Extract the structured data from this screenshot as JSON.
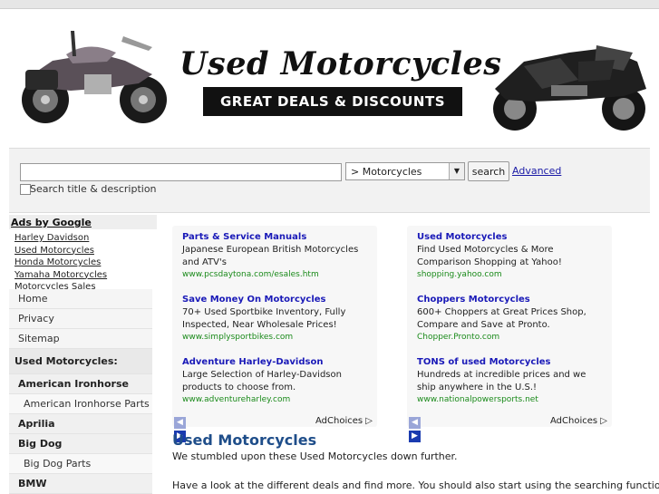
{
  "header": {
    "title": "Used Motorcycles",
    "subtitle": "GREAT DEALS & DISCOUNTS"
  },
  "search": {
    "value": "",
    "category_selected": "> Motorcycles",
    "button_label": "search",
    "advanced_label": "Advanced",
    "checkbox_label": "Search title & description"
  },
  "sidebar": {
    "ads_header": "Ads by Google",
    "ad_links": [
      "Harley Davidson",
      "Used Motorcycles",
      "Honda Motorcycles",
      "Yamaha Motorcycles",
      "Motorcycles Sales"
    ],
    "menu": [
      {
        "label": "Home",
        "type": "item"
      },
      {
        "label": "Privacy",
        "type": "item"
      },
      {
        "label": "Sitemap",
        "type": "item"
      },
      {
        "label": "Used Motorcycles:",
        "type": "head"
      },
      {
        "label": "American Ironhorse",
        "type": "cat"
      },
      {
        "label": "American Ironhorse Parts",
        "type": "sub"
      },
      {
        "label": "Aprilia",
        "type": "cat"
      },
      {
        "label": "Big Dog",
        "type": "cat"
      },
      {
        "label": "Big Dog Parts",
        "type": "sub"
      },
      {
        "label": "BMW",
        "type": "cat"
      }
    ]
  },
  "ads_left": [
    {
      "title": "Parts & Service Manuals",
      "text": "Japanese European British Motorcycles and ATV's",
      "url": "www.pcsdaytona.com/esales.htm"
    },
    {
      "title": "Save Money On Motorcycles",
      "text": "70+ Used Sportbike Inventory, Fully Inspected, Near Wholesale Prices!",
      "url": "www.simplysportbikes.com"
    },
    {
      "title": "Adventure Harley-Davidson",
      "text": "Large Selection of Harley-Davidson products to choose from.",
      "url": "www.adventureharley.com"
    }
  ],
  "ads_right": [
    {
      "title": "Used Motorcycles",
      "text": "Find Used Motorcycles & More Comparison Shopping at Yahoo!",
      "url": "shopping.yahoo.com"
    },
    {
      "title": "Choppers Motorcycles",
      "text": "600+ Choppers at Great Prices Shop, Compare and Save at Pronto.",
      "url": "Chopper.Pronto.com"
    },
    {
      "title": "TONS of used Motorcycles",
      "text": "Hundreds at incredible prices and we ship anywhere in the U.S.!",
      "url": "www.nationalpowersports.net"
    }
  ],
  "adchoices_label": "AdChoices",
  "content": {
    "title": "Used Motorcycles",
    "p1": "We stumbled upon these Used Motorcycles down further.",
    "p2": "Have a look at the different deals and find more. You should also start using the searching function"
  }
}
